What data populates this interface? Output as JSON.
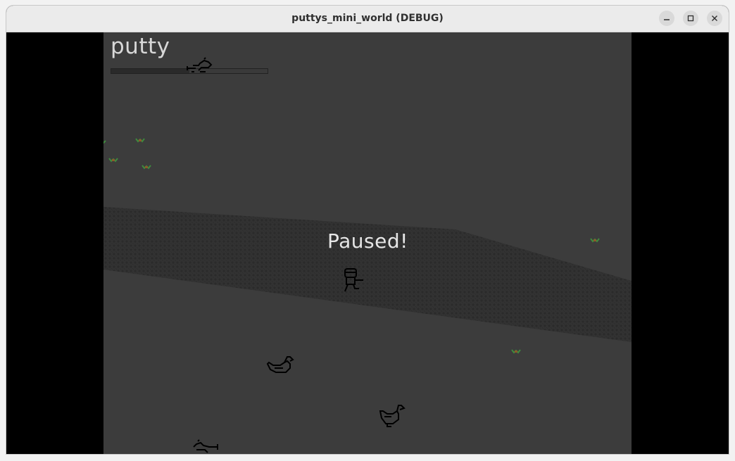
{
  "window": {
    "title": "puttys_mini_world (DEBUG)",
    "controls": [
      "minimize",
      "maximize",
      "close"
    ]
  },
  "hud": {
    "player_name": "putty",
    "health_fraction": 0.5
  },
  "overlay": {
    "paused_text": "Paused!"
  },
  "colors": {
    "ground": "#3c3c3c",
    "road": "#303030",
    "letterbox": "#000000",
    "plant_leaf": "#3e8a3e",
    "plant_flower": "#8a5a2a"
  },
  "entities": [
    "player-character",
    "duck",
    "duck",
    "lizard",
    "lizard",
    "plant",
    "plant",
    "plant",
    "plant",
    "plant",
    "plant"
  ]
}
